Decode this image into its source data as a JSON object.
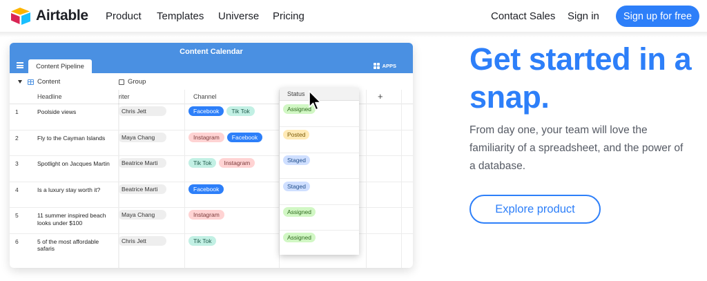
{
  "nav": {
    "brand": "Airtable",
    "links": [
      "Product",
      "Templates",
      "Universe",
      "Pricing"
    ],
    "contact_sales": "Contact Sales",
    "sign_in": "Sign in",
    "signup": "Sign up for free"
  },
  "app": {
    "title": "Content Calendar",
    "tab": "Content Pipeline",
    "apps_label": "APPS",
    "toolbar": {
      "view": "Content",
      "group": "Group"
    },
    "columns": {
      "headline": "Headline",
      "writer": "riter",
      "channel": "Channel",
      "status": "Status",
      "add": "+"
    },
    "rows": [
      {
        "num": "1",
        "headline": "Poolside views",
        "writer": "Chris Jett",
        "channels": [
          "Facebook",
          "Tik Tok"
        ],
        "status": "Assigned"
      },
      {
        "num": "2",
        "headline": "Fly to the Cayman Islands",
        "writer": "Maya Chang",
        "channels": [
          "Instagram",
          "Facebook"
        ],
        "status": "Posted"
      },
      {
        "num": "3",
        "headline": "Spotlight on Jacques Martin",
        "writer": "Beatrice Marti",
        "channels": [
          "Tik Tok",
          "Instagram"
        ],
        "status": "Staged"
      },
      {
        "num": "4",
        "headline": "Is a luxury stay worth it?",
        "writer": "Beatrice Marti",
        "channels": [
          "Facebook"
        ],
        "status": "Staged"
      },
      {
        "num": "5",
        "headline": "11 summer inspired beach looks under $100",
        "writer": "Maya Chang",
        "channels": [
          "Instagram"
        ],
        "status": "Assigned"
      },
      {
        "num": "6",
        "headline": "5 of the most affordable safaris",
        "writer": "Chris Jett",
        "channels": [
          "Tik Tok"
        ],
        "status": "Assigned"
      }
    ]
  },
  "hero": {
    "title": "Get started in a snap.",
    "body": "From day one, your team will love the familiarity of a spreadsheet, and the power of a database.",
    "cta": "Explore product"
  },
  "colors": {
    "brand_blue": "#2d7ff9",
    "app_header": "#4a90e2",
    "facebook": "#2d7ff9",
    "tiktok": "#c2f0e4",
    "instagram": "#ffd3d3",
    "assigned": "#d1f7c4",
    "posted": "#ffeab6",
    "staged": "#cfdfff"
  },
  "icons": [
    "airtable-logo-icon",
    "menu-icon",
    "apps-grid-icon",
    "grid-view-icon",
    "group-icon",
    "cursor-icon"
  ]
}
